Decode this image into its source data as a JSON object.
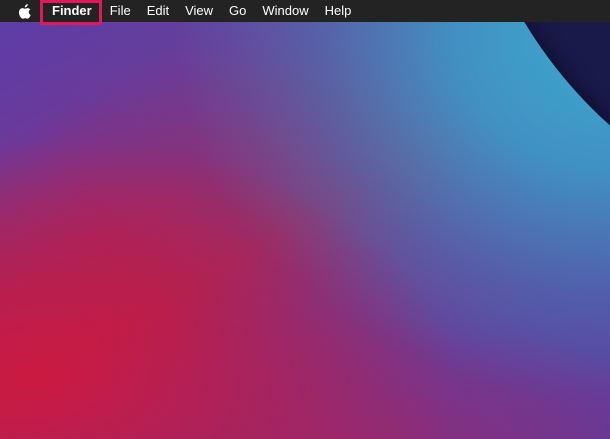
{
  "menubar": {
    "apple_menu": "apple-icon",
    "app_name": "Finder",
    "items": [
      {
        "label": "File"
      },
      {
        "label": "Edit"
      },
      {
        "label": "View"
      },
      {
        "label": "Go"
      },
      {
        "label": "Window"
      },
      {
        "label": "Help"
      }
    ]
  },
  "highlight": {
    "target": "Finder",
    "color": "#e2185a"
  },
  "colors": {
    "menubar_bg": "#232323",
    "menubar_text": "#ffffff",
    "wallpaper_blue": "#3aaacd",
    "wallpaper_purple": "#5a3fa8",
    "wallpaper_red": "#b81f4a",
    "wallpaper_dark": "#1a1a4a"
  }
}
